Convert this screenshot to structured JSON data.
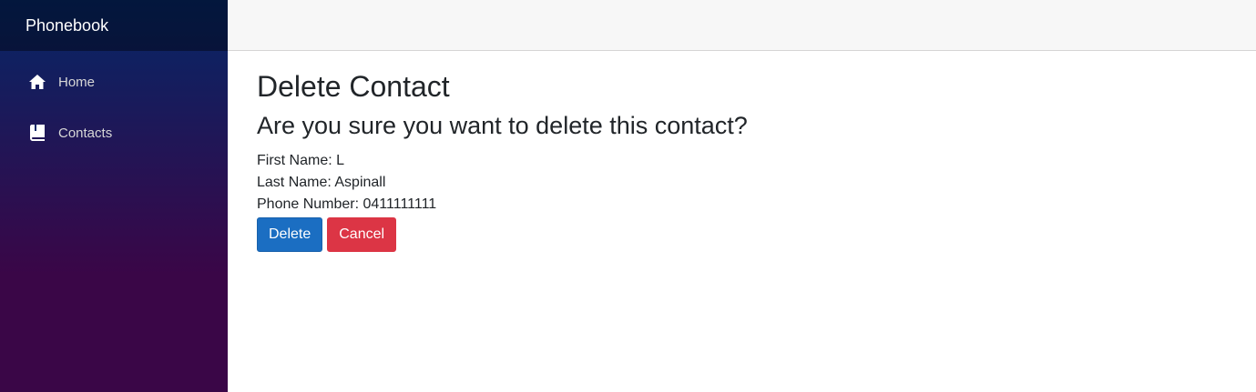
{
  "sidebar": {
    "brand": "Phonebook",
    "items": [
      {
        "label": "Home",
        "icon": "home-icon"
      },
      {
        "label": "Contacts",
        "icon": "book-icon"
      }
    ]
  },
  "main": {
    "title": "Delete Contact",
    "question": "Are you sure you want to delete this contact?",
    "contact": {
      "first_name": "First Name: L",
      "last_name": "Last Name: Aspinall",
      "phone_number": "Phone Number: 0411111111"
    },
    "buttons": {
      "delete": "Delete",
      "cancel": "Cancel"
    }
  },
  "colors": {
    "primary": "#1b6ec2",
    "danger": "#dc3545",
    "sidebar_top": "#052767",
    "sidebar_bottom": "#3a0647"
  }
}
